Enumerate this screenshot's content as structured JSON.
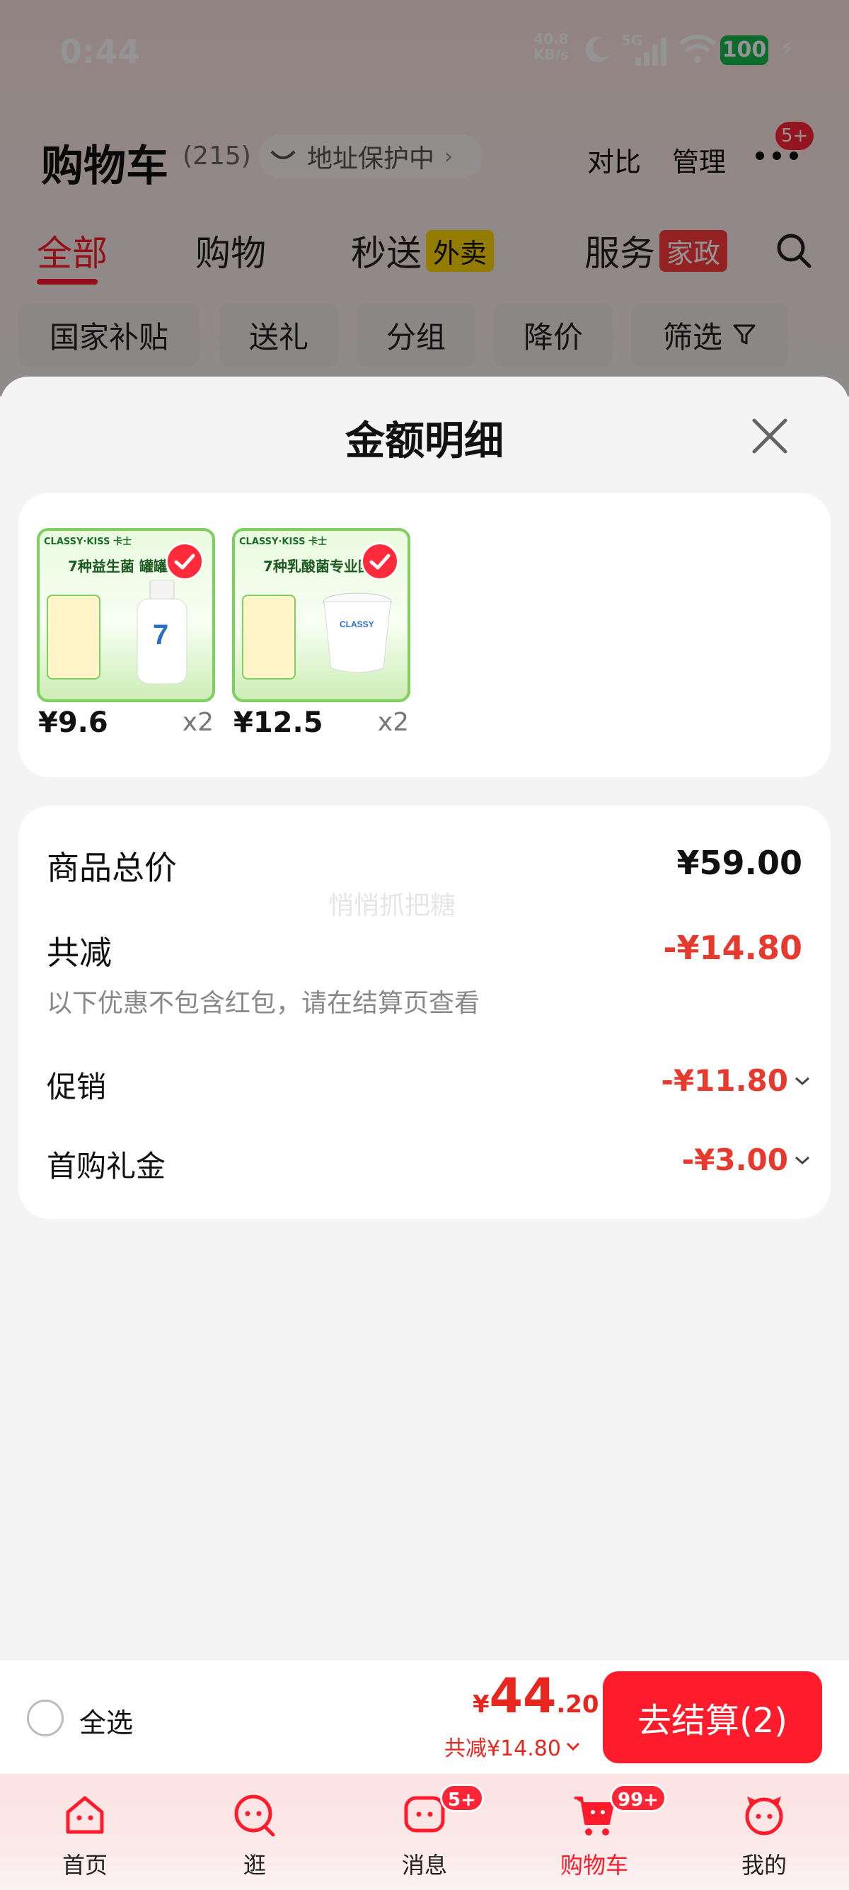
{
  "status_bar": {
    "time": "0:44",
    "net_speed_value": "40.8",
    "net_speed_unit": "KB/s",
    "network": "5G",
    "battery": "100",
    "icons": [
      "moon-icon",
      "signal-icon",
      "wifi-icon",
      "battery-icon",
      "charging-icon"
    ]
  },
  "header": {
    "title": "购物车",
    "count": "(215)",
    "address_protection": "地址保护中",
    "compare": "对比",
    "manage": "管理",
    "more_badge": "5+"
  },
  "tabs": [
    {
      "label": "全部",
      "tag": ""
    },
    {
      "label": "购物",
      "tag": ""
    },
    {
      "label": "秒送",
      "tag": "外卖"
    },
    {
      "label": "服务",
      "tag": "家政"
    }
  ],
  "filters": [
    "国家补贴",
    "送礼",
    "分组",
    "降价",
    "筛选"
  ],
  "sheet": {
    "title": "金额明细",
    "products": [
      {
        "brand": "CLASSY·KISS 卡士",
        "slogan": "7种益生菌 罐罐杯",
        "price": "¥9.6",
        "qty": "x2"
      },
      {
        "brand": "CLASSY·KISS 卡士",
        "slogan": "7种乳酸菌专业团",
        "price": "¥12.5",
        "qty": "x2"
      }
    ],
    "detail": {
      "total_label": "商品总价",
      "total_value": "¥59.00",
      "reduction_label": "共减",
      "reduction_value": "-¥14.80",
      "note": "以下优惠不包含红包，请在结算页查看",
      "promo_label": "促销",
      "promo_value": "-¥11.80",
      "gift_label": "首购礼金",
      "gift_value": "-¥3.00",
      "watermark": "悄悄抓把糖"
    }
  },
  "checkout": {
    "select_all": "全选",
    "currency": "¥",
    "amount_int": "44",
    "amount_dec": ".20",
    "savings": "共减¥14.80",
    "button": "去结算(2)"
  },
  "bottom_nav": [
    {
      "label": "首页",
      "badge": "",
      "active": false
    },
    {
      "label": "逛",
      "badge": "",
      "active": false
    },
    {
      "label": "消息",
      "badge": "5+",
      "active": false
    },
    {
      "label": "购物车",
      "badge": "99+",
      "active": true
    },
    {
      "label": "我的",
      "badge": "",
      "active": false
    }
  ],
  "colors": {
    "accent": "#ff1b2c",
    "discount": "#e63a2e",
    "battery": "#16b84f"
  }
}
